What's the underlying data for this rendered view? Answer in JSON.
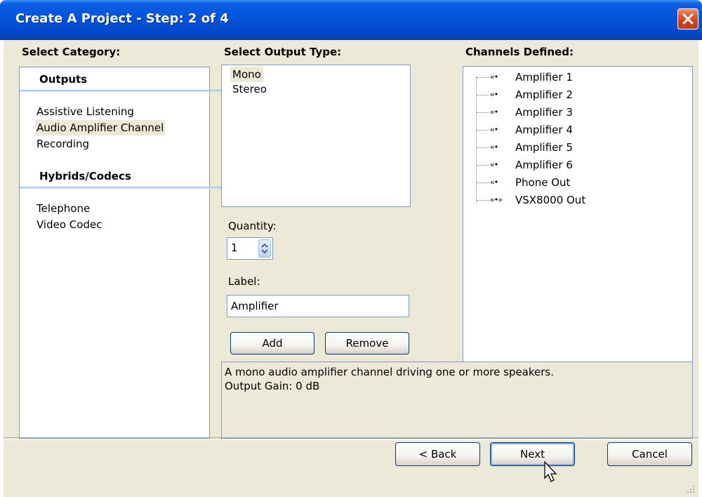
{
  "window": {
    "title": "Create A Project - Step: 2 of 4"
  },
  "category": {
    "heading": "Select Category:",
    "groups": [
      {
        "title": "Outputs",
        "items": [
          "Assistive Listening",
          "Audio Amplifier Channel",
          "Recording"
        ]
      },
      {
        "title": "Hybrids/Codecs",
        "items": [
          "Telephone",
          "Video Codec"
        ]
      }
    ],
    "selected": "Audio Amplifier Channel"
  },
  "output_type": {
    "heading": "Select Output Type:",
    "items": [
      "Mono",
      "Stereo"
    ],
    "selected": "Mono"
  },
  "quantity": {
    "label": "Quantity:",
    "value": "1"
  },
  "label_field": {
    "label": "Label:",
    "value": "Amplifier"
  },
  "buttons": {
    "add": "Add",
    "remove": "Remove",
    "back": "< Back",
    "next": "Next",
    "cancel": "Cancel"
  },
  "channels": {
    "heading": "Channels Defined:",
    "items": [
      {
        "label": "Amplifier 1",
        "icon": "mono-output-icon"
      },
      {
        "label": "Amplifier 2",
        "icon": "mono-output-icon"
      },
      {
        "label": "Amplifier 3",
        "icon": "mono-output-icon"
      },
      {
        "label": "Amplifier 4",
        "icon": "mono-output-icon"
      },
      {
        "label": "Amplifier 5",
        "icon": "mono-output-icon"
      },
      {
        "label": "Amplifier 6",
        "icon": "mono-output-icon"
      },
      {
        "label": "Phone Out",
        "icon": "mono-output-icon"
      },
      {
        "label": "VSX8000 Out",
        "icon": "stereo-output-icon"
      }
    ]
  },
  "description": {
    "line1": "A mono audio amplifier channel driving one or more speakers.",
    "line2": "Output Gain: 0 dB"
  },
  "colors": {
    "titlebar": "#0253d8",
    "dialog_bg": "#ece9d8",
    "border": "#7f9db9",
    "close": "#d4441c"
  }
}
